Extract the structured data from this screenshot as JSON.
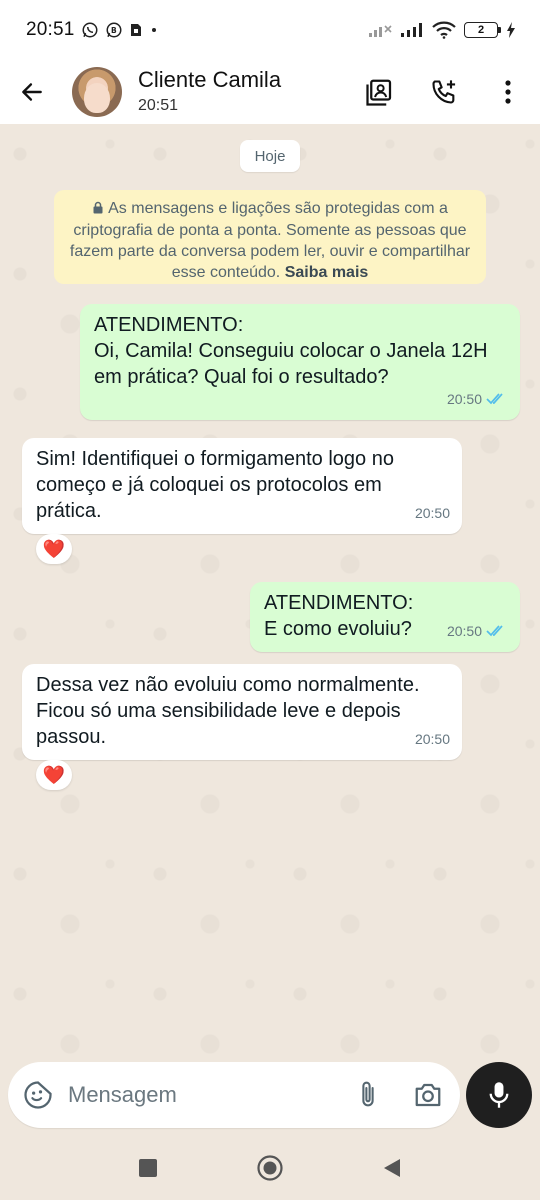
{
  "status_bar": {
    "time": "20:51",
    "battery_level": "2",
    "icons": [
      "whatsapp-icon",
      "whatsapp-business-icon",
      "sim-icon",
      "dot-icon",
      "no-signal-icon",
      "signal-icon",
      "wifi-icon",
      "battery-icon",
      "charging-icon"
    ]
  },
  "header": {
    "contact_name": "Cliente Camila",
    "subtitle": "20:51",
    "actions": [
      "contact-card-icon",
      "add-call-icon",
      "more-vert-icon"
    ]
  },
  "chat": {
    "date_chip": "Hoje",
    "notice": {
      "text": "As mensagens e ligações são protegidas com a criptografia de ponta a ponta. Somente as pessoas que fazem parte da conversa podem ler, ouvir e compartilhar esse conteúdo.",
      "link": "Saiba mais"
    },
    "messages": [
      {
        "direction": "out",
        "text": "ATENDIMENTO:\nOi, Camila! Conseguiu colocar o Janela 12H em prática? Qual foi o resultado?",
        "time": "20:50",
        "status": "read"
      },
      {
        "direction": "in",
        "text": "Sim! Identifiquei o formigamento logo no começo e já coloquei os protocolos em prática.",
        "time": "20:50",
        "reaction": "❤️"
      },
      {
        "direction": "out",
        "text": "ATENDIMENTO:\nE como evoluiu?",
        "time": "20:50",
        "status": "read"
      },
      {
        "direction": "in",
        "text": "Dessa vez não evoluiu como normalmente. Ficou só uma sensibilidade leve e depois passou.",
        "time": "20:50",
        "reaction": "❤️"
      }
    ]
  },
  "input": {
    "placeholder": "Mensagem"
  },
  "colors": {
    "outgoing_bubble": "#d9fdd3",
    "incoming_bubble": "#ffffff",
    "read_ticks": "#53bdeb",
    "notice_bg": "#fdf4c5",
    "chat_bg": "#efe7dd"
  }
}
